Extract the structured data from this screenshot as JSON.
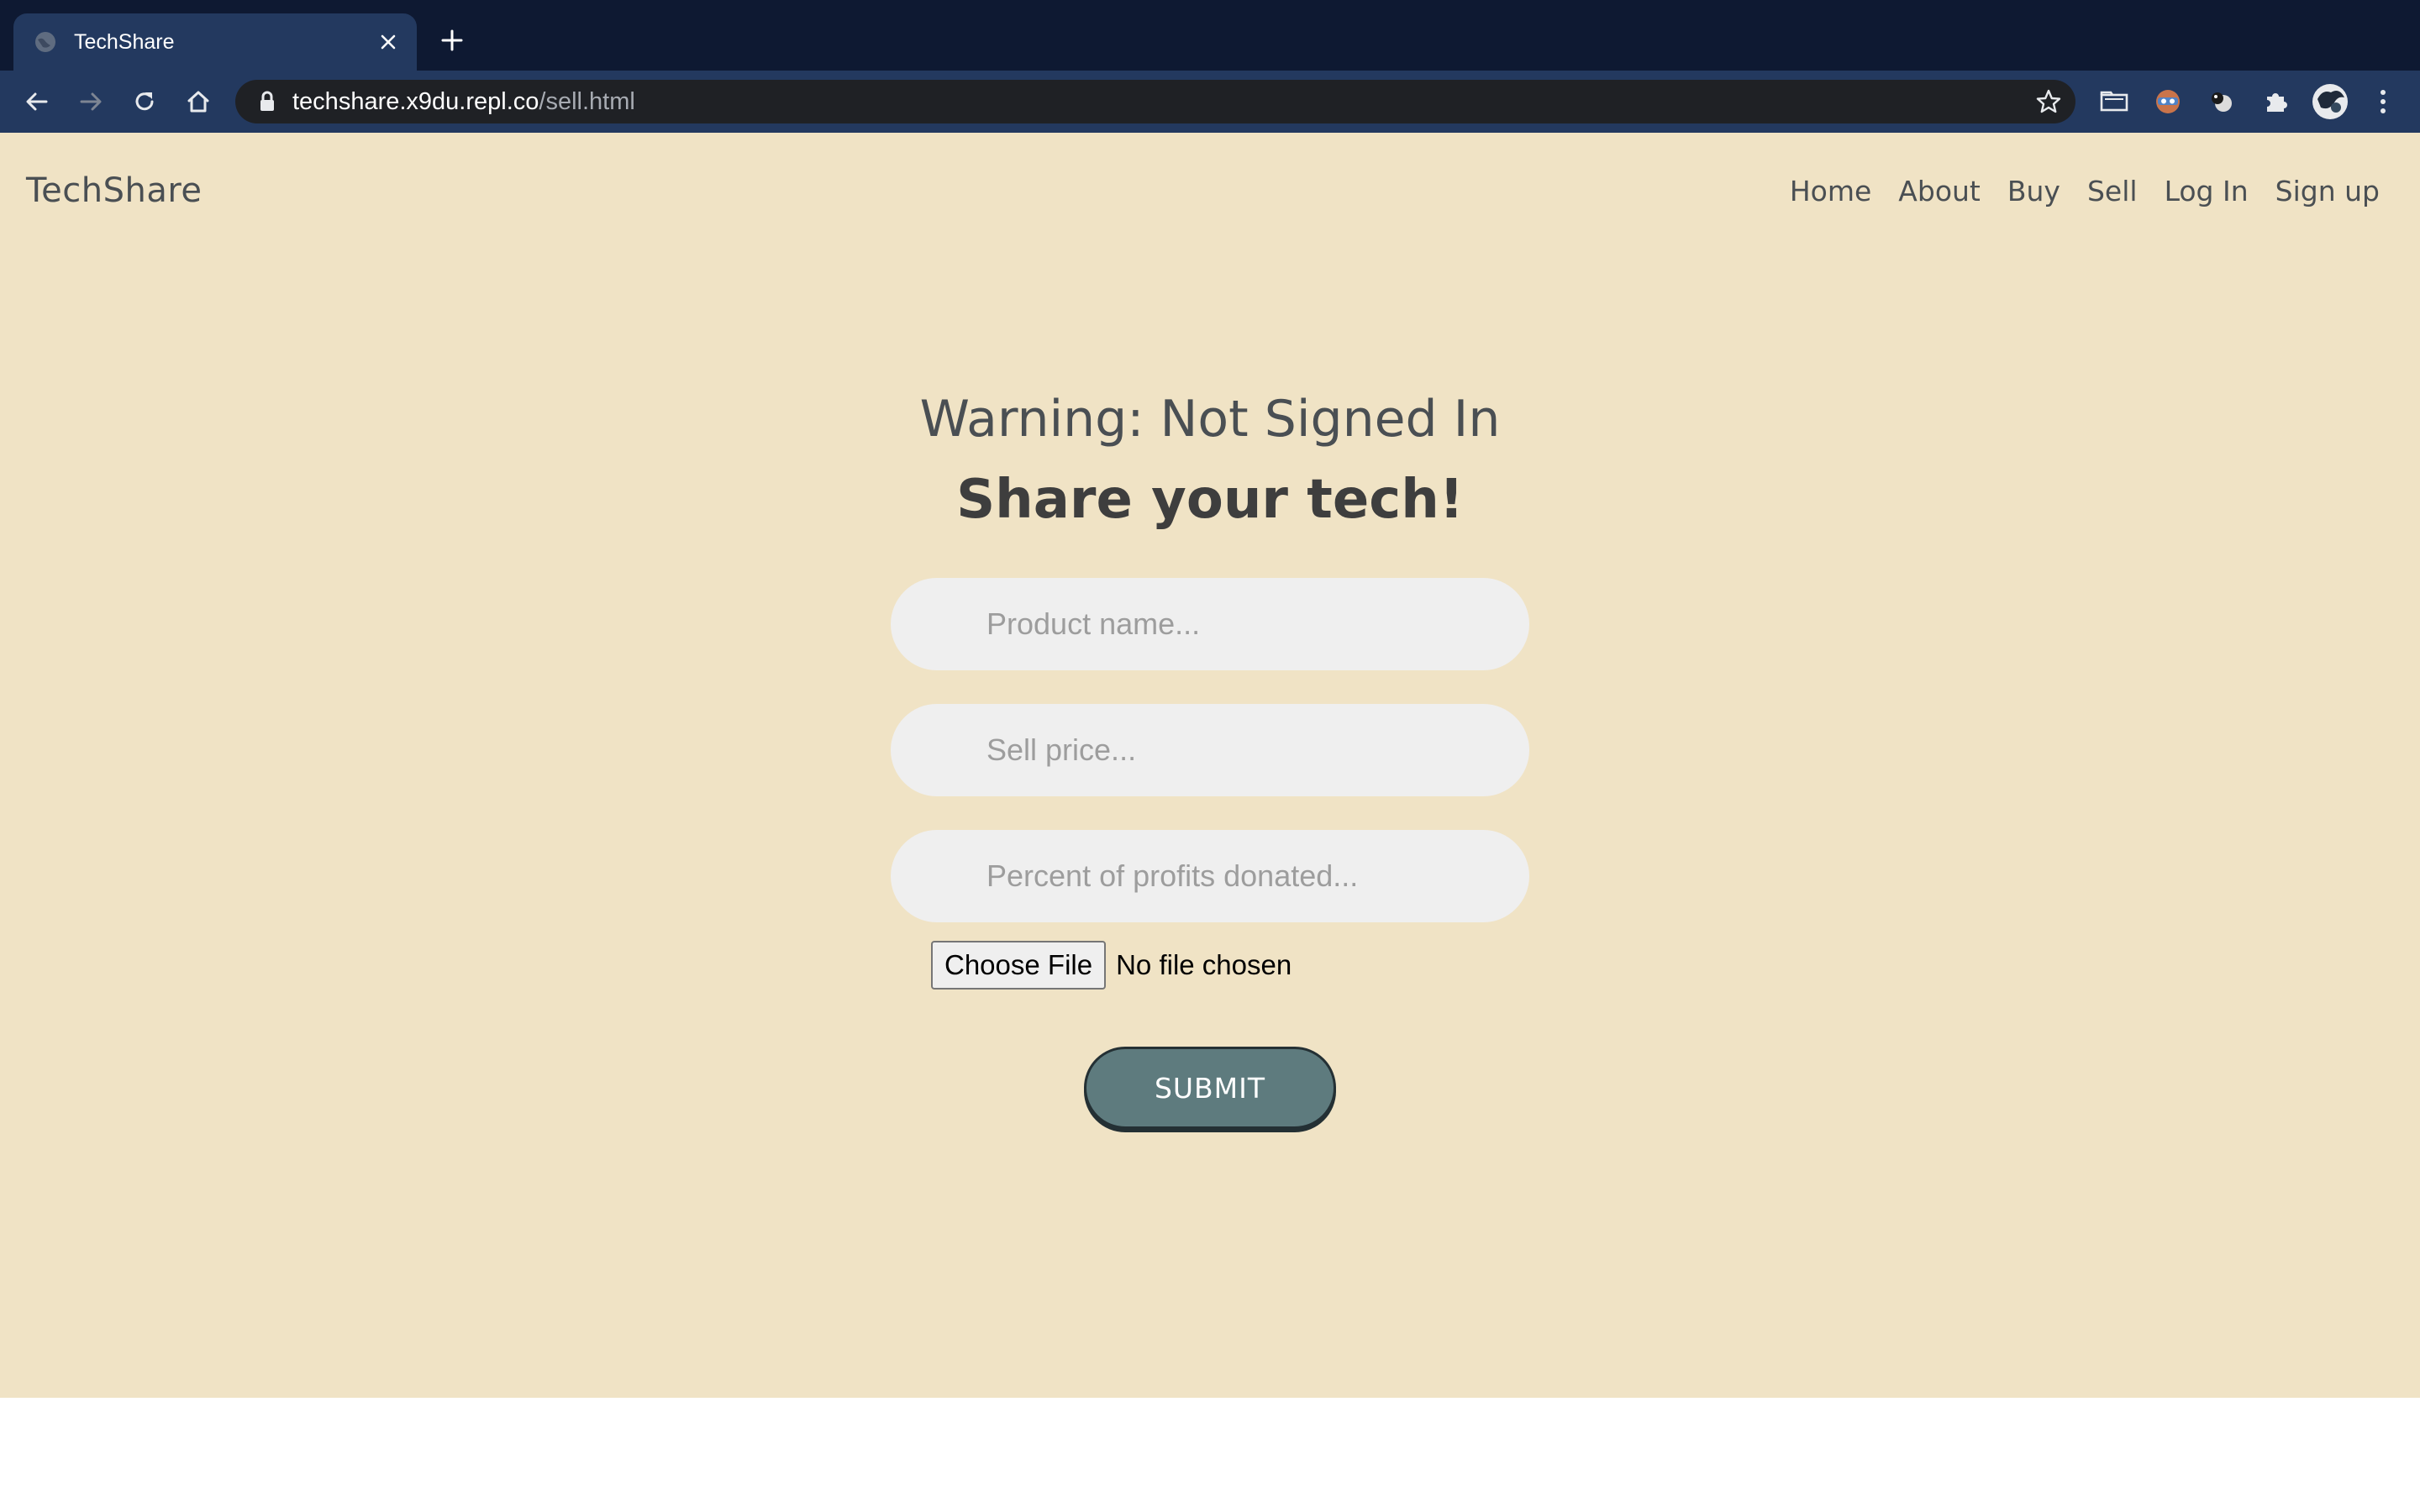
{
  "browser": {
    "tab_title": "TechShare",
    "url_host": "techshare.x9du.repl.co",
    "url_path": "/sell.html",
    "icons": [
      "globe-icon",
      "close-icon",
      "plus-icon",
      "back-icon",
      "forward-icon",
      "reload-icon",
      "home-icon",
      "lock-icon",
      "star-icon",
      "folder-extension-icon",
      "eyes-extension-icon",
      "ball-extension-icon",
      "puzzle-extension-icon",
      "profile-avatar-icon",
      "kebab-menu-icon"
    ]
  },
  "site": {
    "brand": "TechShare",
    "nav": [
      "Home",
      "About",
      "Buy",
      "Sell",
      "Log In",
      "Sign up"
    ]
  },
  "main": {
    "warning": "Warning: Not Signed In",
    "headline": "Share your tech!",
    "product_placeholder": "Product name...",
    "price_placeholder": "Sell price...",
    "donation_placeholder": "Percent of profits donated...",
    "file_button": "Choose File",
    "file_status": "No file chosen",
    "submit_label": "SUBMIT"
  },
  "colors": {
    "chrome_dark": "#0e1932",
    "chrome_toolbar": "#23395f",
    "page_background": "#f0e3c5",
    "input_background": "#efefef",
    "submit_button": "#5e7b7e",
    "text": "#4a4f53"
  }
}
